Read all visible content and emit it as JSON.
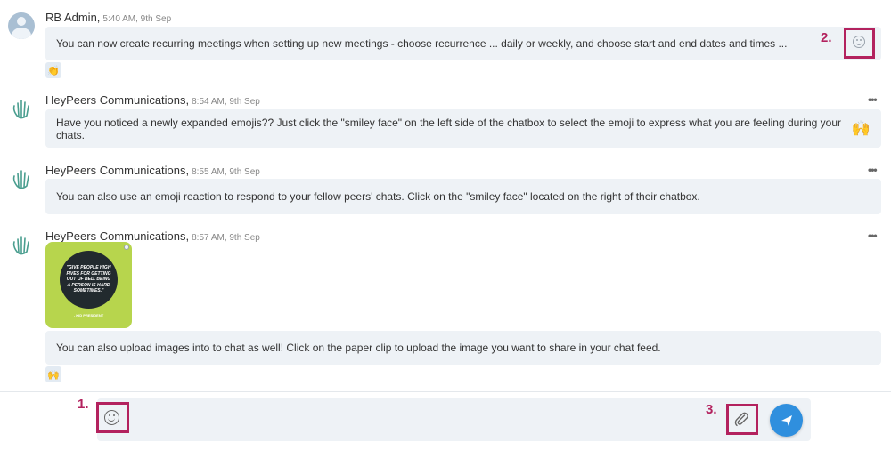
{
  "colors": {
    "highlight": "#b3225e",
    "bubble": "#eef2f6",
    "send": "#2f8fde"
  },
  "messages": [
    {
      "author": "RB Admin,",
      "time": "5:40 AM, 9th Sep",
      "text": "You can now create recurring meetings when setting up new meetings - choose recurrence ... daily or weekly, and choose start and end dates and times ...",
      "reaction": "👏",
      "avatar": "user-avatar"
    },
    {
      "author": "HeyPeers Communications,",
      "time": "8:54 AM, 9th Sep",
      "text": "Have you noticed a newly expanded emojis?? Just click the \"smiley face\" on the left side of the chatbox to select the emoji to express what you are feeling during your chats.",
      "emoji": "🙌",
      "more": "•••",
      "avatar": "wave-icon"
    },
    {
      "author": "HeyPeers Communications,",
      "time": "8:55 AM, 9th Sep",
      "text": "You can also use an emoji reaction to respond to your fellow peers' chats. Click on the \"smiley face\" located on the right of their chatbox.",
      "more": "•••",
      "avatar": "wave-icon"
    },
    {
      "author": "HeyPeers Communications,",
      "time": "8:57 AM, 9th Sep",
      "image": {
        "quote": "\"GIVE PEOPLE HIGH FIVES FOR GETTING OUT OF BED. BEING A PERSON IS HARD SOMETIMES.\"",
        "attribution": "- KID PRESIDENT"
      },
      "text": "You can also upload images into to chat as well! Click on the paper clip to upload the image you want to share in your chat feed.",
      "reaction": "🙌",
      "more": "•••",
      "avatar": "wave-icon"
    }
  ],
  "annotations": {
    "label1": "1.",
    "label2": "2.",
    "label3": "3."
  },
  "composer": {
    "placeholder": "",
    "icons": [
      "smiley-icon",
      "paperclip-icon",
      "send-icon"
    ]
  }
}
